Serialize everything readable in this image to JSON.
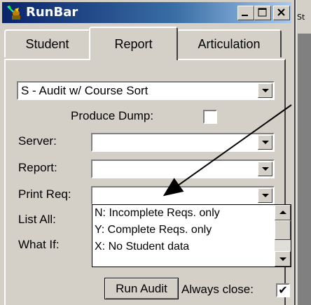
{
  "window": {
    "title": "RunBar",
    "side_strip_text": "St"
  },
  "tabs": [
    {
      "label": "Student",
      "selected": false
    },
    {
      "label": "Report",
      "selected": true
    },
    {
      "label": "Articulation",
      "selected": false
    }
  ],
  "report_panel": {
    "audit_type_value": "S - Audit w/ Course Sort",
    "produce_dump_label": "Produce Dump:",
    "produce_dump_checked": false,
    "server_label": "Server:",
    "server_value": "",
    "report_label": "Report:",
    "report_value": "",
    "print_req_label": "Print Req:",
    "print_req_value": "",
    "list_all_label": "List All:",
    "what_if_label": "What If:",
    "print_req_options": [
      "N:  Incomplete Reqs. only",
      "Y:  Complete Reqs. only",
      "X:  No Student data"
    ],
    "run_audit_label": "Run Audit",
    "always_close_label": "Always close:",
    "always_close_checked": true,
    "check_glyph": "✔"
  },
  "colors": {
    "titlebar_start": "#0a246a",
    "titlebar_end": "#a6caf0",
    "window_bg": "#d4d0c8",
    "annotation_arrow": "#000000"
  },
  "icons": [
    "runbar-app-icon",
    "minimize-icon",
    "maximize-icon",
    "close-icon",
    "chevron-down-icon",
    "scroll-up-icon",
    "scroll-down-icon",
    "annotation-arrow"
  ]
}
